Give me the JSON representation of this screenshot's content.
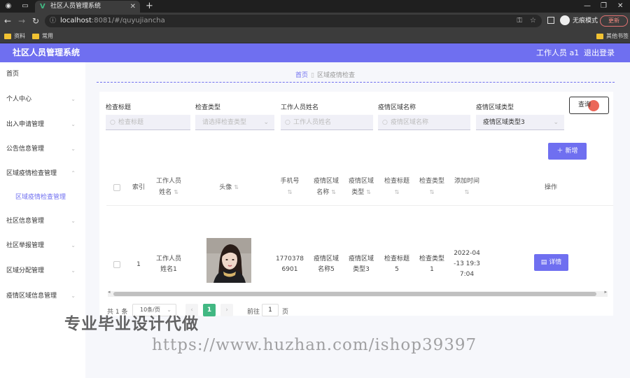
{
  "browser": {
    "tab_title": "社区人员管理系统",
    "tab_logo": "V",
    "url_host": "localhost",
    "url_rest": ":8081/#/quyujiancha",
    "incognito_label": "无痕模式",
    "update_label": "更新",
    "bookmarks": [
      "资料",
      "常用"
    ],
    "other_bookmarks": "其他书签"
  },
  "header": {
    "title": "社区人员管理系统",
    "user": "工作人员 a1",
    "logout": "退出登录"
  },
  "sidebar": {
    "items": [
      {
        "label": "首页",
        "chevron": false,
        "sub": false
      },
      {
        "label": "个人中心",
        "chevron": true,
        "sub": false
      },
      {
        "label": "出入申请管理",
        "chevron": true,
        "sub": false
      },
      {
        "label": "公告信息管理",
        "chevron": true,
        "sub": false
      },
      {
        "label": "区域疫情检查管理",
        "chevron": true,
        "sub": false
      },
      {
        "label": "区域疫情检查管理",
        "chevron": false,
        "sub": true
      },
      {
        "label": "社区信息管理",
        "chevron": true,
        "sub": false
      },
      {
        "label": "社区举报管理",
        "chevron": true,
        "sub": false
      },
      {
        "label": "区域分配管理",
        "chevron": true,
        "sub": false
      },
      {
        "label": "疫情区域信息管理",
        "chevron": true,
        "sub": false
      }
    ]
  },
  "breadcrumb": {
    "home": "首页",
    "current": "区域疫情检查"
  },
  "filters": {
    "title_label": "检查标题",
    "title_placeholder": "检查标题",
    "type_label": "检查类型",
    "type_placeholder": "请选择检查类型",
    "worker_label": "工作人员姓名",
    "worker_placeholder": "工作人员姓名",
    "area_name_label": "疫情区域名称",
    "area_name_placeholder": "疫情区域名称",
    "area_type_label": "疫情区域类型",
    "area_type_value": "疫情区域类型3",
    "query_button": "查询"
  },
  "actions": {
    "add_button": "新增"
  },
  "table": {
    "headers": {
      "index": "索引",
      "worker": [
        "工作人员",
        "姓名"
      ],
      "avatar": "头像",
      "phone": "手机号",
      "area_name": [
        "疫情区域",
        "名称"
      ],
      "area_type": [
        "疫情区域",
        "类型"
      ],
      "check_title": "检查标题",
      "check_type": "检查类型",
      "added_time": "添加时间",
      "operation": "操作"
    },
    "rows": [
      {
        "index": "1",
        "worker": [
          "工作人员",
          "姓名1"
        ],
        "phone": [
          "1770378",
          "6901"
        ],
        "area_name": [
          "疫情区域",
          "名称5"
        ],
        "area_type": [
          "疫情区域",
          "类型3"
        ],
        "check_title": [
          "检查标题",
          "5"
        ],
        "check_type": [
          "检查类型",
          "1"
        ],
        "added_time": [
          "2022-04",
          "-13 19:3",
          "7:04"
        ],
        "detail_button": "详情"
      }
    ]
  },
  "pagination": {
    "total": "共 1 条",
    "page_size": "10条/页",
    "current_page": "1",
    "goto_label": "前往",
    "goto_value": "1",
    "page_unit": "页"
  },
  "watermark": {
    "line1": "专业毕业设计代做",
    "line2": "https://www.huzhan.com/ishop39397"
  },
  "colors": {
    "accent": "#6f6ff0",
    "pager": "#42b883",
    "cursor_dot": "#e74c3c"
  }
}
